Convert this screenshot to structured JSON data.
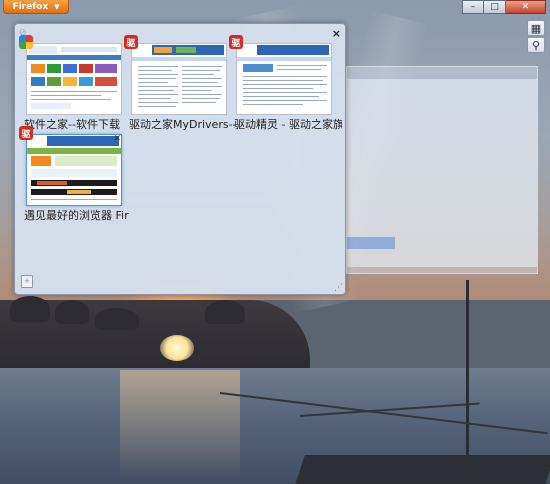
{
  "titlebar": {
    "app_button_label": "Firefox",
    "controls": {
      "minimize": "–",
      "maximize": "□",
      "close": "✕"
    }
  },
  "toolbar": {
    "tab_groups_icon": "tab-groups-icon",
    "search_icon": "search-icon"
  },
  "panel": {
    "close_label": "×",
    "tabs": [
      {
        "title": "软件之家--软件下载",
        "favicon": "rainbow-logo"
      },
      {
        "title": "驱动之家MyDrivers--",
        "favicon": "mydrivers-logo"
      },
      {
        "title": "驱动精灵 - 驱动之家旗",
        "favicon": "mydrivers-logo"
      },
      {
        "title": "遇见最好的浏览器 Fir",
        "favicon": "mydrivers-logo"
      }
    ]
  },
  "colors": {
    "firefox_orange": "#e8791c",
    "panel_bg": "#d6e2f0",
    "active_outline": "#5d91cf",
    "logo_red": "#d52b1e"
  }
}
